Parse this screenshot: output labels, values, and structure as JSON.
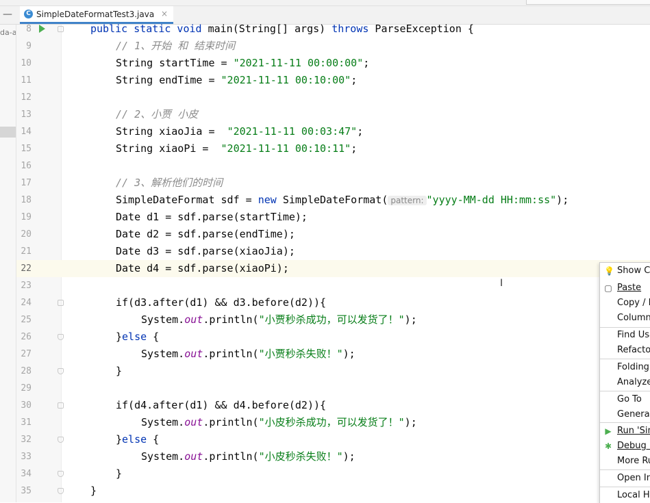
{
  "editor_tab": {
    "filename": "SimpleDateFormatTest3.java",
    "file_icon": "C",
    "close_glyph": "×"
  },
  "project_panel": {
    "truncated_label": "da-a"
  },
  "code_lines": [
    {
      "n": "8"
    },
    {
      "n": "9"
    },
    {
      "n": "10"
    },
    {
      "n": "11"
    },
    {
      "n": "12"
    },
    {
      "n": "13"
    },
    {
      "n": "14"
    },
    {
      "n": "15"
    },
    {
      "n": "16"
    },
    {
      "n": "17"
    },
    {
      "n": "18"
    },
    {
      "n": "19"
    },
    {
      "n": "20"
    },
    {
      "n": "21"
    },
    {
      "n": "22"
    },
    {
      "n": "23"
    },
    {
      "n": "24"
    },
    {
      "n": "25"
    },
    {
      "n": "26"
    },
    {
      "n": "27"
    },
    {
      "n": "28"
    },
    {
      "n": "29"
    },
    {
      "n": "30"
    },
    {
      "n": "31"
    },
    {
      "n": "32"
    },
    {
      "n": "33"
    },
    {
      "n": "34"
    },
    {
      "n": "35"
    }
  ],
  "code": {
    "l8_kw": "public static void",
    "l8_rest": " main(String[] args) ",
    "l8_throws": "throws",
    "l8_end": " ParseException {",
    "l9": "// 1、开始 和 结束时间",
    "l10_a": "String startTime = ",
    "l10_s": "\"2021-11-11 00:00:00\"",
    "l10_e": ";",
    "l11_a": "String endTime = ",
    "l11_s": "\"2021-11-11 00:10:00\"",
    "l11_e": ";",
    "l13": "// 2、小贾 小皮",
    "l14_a": "String xiaoJia =  ",
    "l14_s": "\"2021-11-11 00:03:47\"",
    "l14_e": ";",
    "l15_a": "String xiaoPi =  ",
    "l15_s": "\"2021-11-11 00:10:11\"",
    "l15_e": ";",
    "l17": "// 3、解析他们的时间",
    "l18_a": "SimpleDateFormat sdf = ",
    "l18_new": "new",
    "l18_b": " SimpleDateFormat(",
    "l18_hint": "pattern:",
    "l18_s": "\"yyyy-MM-dd HH:mm:ss\"",
    "l18_e": ");",
    "l19": "Date d1 = sdf.parse(startTime);",
    "l20": "Date d2 = sdf.parse(endTime);",
    "l21": "Date d3 = sdf.parse(xiaoJia);",
    "l22": "Date d4 = sdf.parse(xiaoPi);",
    "l24": "if(d3.after(d1) && d3.before(d2)){",
    "sys": "System.",
    "out": "out",
    "println": ".println(",
    "l25_s": "\"小贾秒杀成功，可以发货了！\"",
    "close_paren": ");",
    "else_close": "}",
    "else_kw": "else",
    "else_open": " {",
    "l27_s": "\"小贾秒杀失败！\"",
    "brace": "}",
    "l30": "if(d4.after(d1) && d4.before(d2)){",
    "l31_s": "\"小皮秒杀成功，可以发货了！\"",
    "l33_s": "\"小皮秒杀失败！\""
  },
  "context_menu": {
    "items": [
      {
        "label": "Show Co",
        "icon": "bulb-icon"
      },
      {
        "label": "Paste",
        "icon": "clipboard-icon"
      },
      {
        "label": "Copy / P"
      },
      {
        "label": "Column"
      },
      {
        "label": "Find Usa"
      },
      {
        "label": "Refactor"
      },
      {
        "label": "Folding"
      },
      {
        "label": "Analyze"
      },
      {
        "label": "Go To"
      },
      {
        "label": "Generat"
      },
      {
        "label": "Run 'Sim",
        "icon": "run-icon"
      },
      {
        "label": "Debug '",
        "icon": "debug-icon"
      },
      {
        "label": "More Ru"
      },
      {
        "label": "Open In"
      },
      {
        "label": "Local Hi"
      }
    ]
  },
  "colors": {
    "keyword": "#0033b3",
    "string": "#067d17",
    "comment": "#8c8c8c",
    "static_field": "#871094",
    "current_line": "#fcfaed"
  }
}
